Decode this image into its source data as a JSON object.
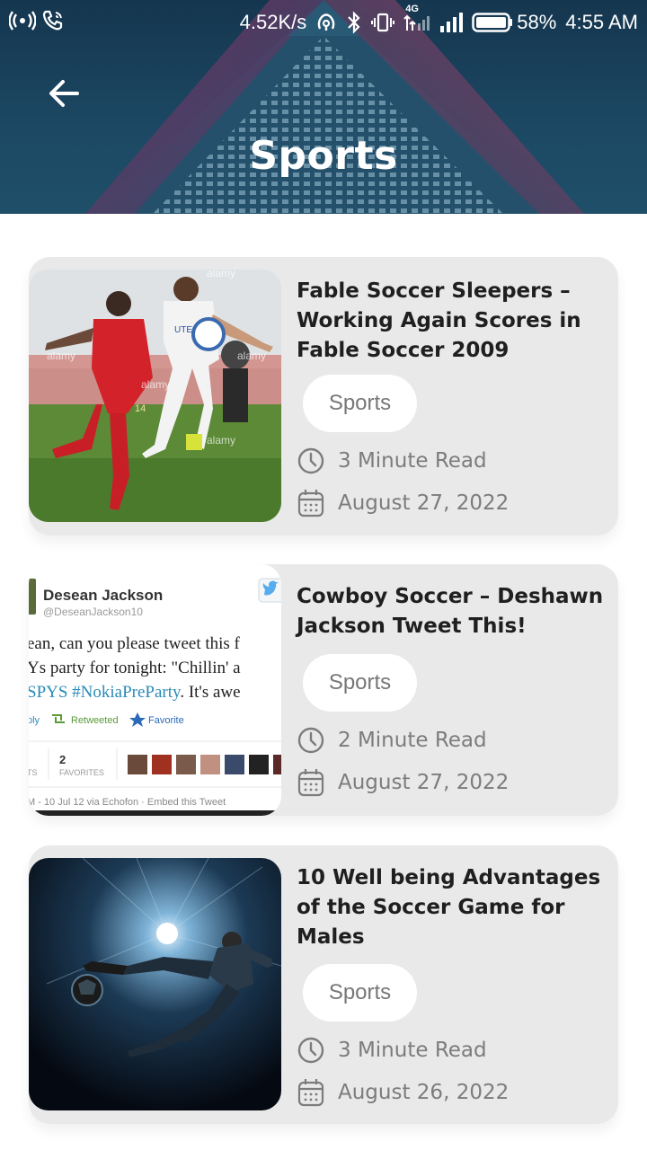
{
  "status_bar": {
    "network_speed": "4.52K/s",
    "network_type": "4G",
    "battery": "58%",
    "time": "4:55 AM"
  },
  "header": {
    "title": "Sports",
    "back_icon": "back-arrow-icon"
  },
  "articles": [
    {
      "title": "Fable Soccer Sleepers – Working Again Scores in Fable Soccer 2009",
      "category": "Sports",
      "read_time": "3 Minute Read",
      "date": "August 27, 2022",
      "thumbnail": {
        "watermarks": [
          "alamy",
          "alamy",
          "alamy",
          "alamy",
          "alamy"
        ],
        "shirt_text": "UTE",
        "player_number": "14"
      }
    },
    {
      "title": "Cowboy Soccer – Deshawn Jackson Tweet This!",
      "category": "Sports",
      "read_time": "2 Minute Read",
      "date": "August 27, 2022",
      "thumbnail": {
        "tweet_name": "Desean Jackson",
        "tweet_handle": "@DeseanJackson10",
        "tweet_line1": "ean, can you please tweet this f",
        "tweet_line2": "Ys party for tonight: \"Chillin' a",
        "tweet_line3_link": "SPYS #NokiaPreParty",
        "tweet_line3_rest": ". It's awe",
        "reply": "ply",
        "retweeted": "Retweeted",
        "favorite": "Favorite",
        "favorites_count": "2",
        "favorites_label": "FAVORITES",
        "stats_fragment": "TS",
        "footer": "M - 10 Jul 12 via Echofon · Embed this Tweet"
      }
    },
    {
      "title": "10 Well being Advantages of the Soccer Game for Males",
      "category": "Sports",
      "read_time": "3 Minute Read",
      "date": "August 26, 2022"
    }
  ],
  "colors": {
    "header_bg": "#1c4863",
    "card_bg": "#e9e9e9",
    "title_text": "#1f1f1f",
    "meta_text": "#7c7c7c",
    "tweet_link": "#2a8ab8"
  }
}
